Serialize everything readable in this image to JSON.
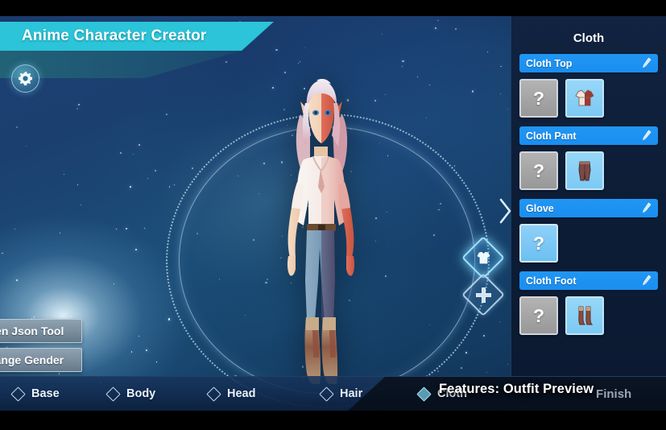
{
  "app": {
    "title": "Anime Character Creator"
  },
  "viewport": {
    "gear_icon": "gear-icon",
    "gizmos": [
      {
        "name": "outfit-gizmo",
        "icon": "shirt-icon",
        "active": true
      },
      {
        "name": "move-gizmo",
        "icon": "move-cross-icon",
        "active": false
      }
    ]
  },
  "tools": {
    "json_button": "Open Json Tool",
    "gender_button": "Change Gender"
  },
  "panel": {
    "title": "Cloth",
    "collapse_icon": "chevron-right-icon",
    "edit_icon": "pencil-icon",
    "categories": [
      {
        "label": "Cloth Top",
        "tiles": [
          {
            "type": "none",
            "label": "?",
            "selected": false
          },
          {
            "type": "item",
            "icon": "shirt-thumbnail",
            "selected": true
          }
        ]
      },
      {
        "label": "Cloth Pant",
        "tiles": [
          {
            "type": "none",
            "label": "?",
            "selected": false
          },
          {
            "type": "item",
            "icon": "pants-thumbnail",
            "selected": true
          }
        ]
      },
      {
        "label": "Glove",
        "tiles": [
          {
            "type": "none",
            "label": "?",
            "selected": true
          }
        ]
      },
      {
        "label": "Cloth Foot",
        "tiles": [
          {
            "type": "none",
            "label": "?",
            "selected": false
          },
          {
            "type": "item",
            "icon": "boots-thumbnail",
            "selected": true
          }
        ]
      }
    ]
  },
  "bottom_nav": {
    "tabs": [
      {
        "label": "Base",
        "active": false
      },
      {
        "label": "Body",
        "active": false
      },
      {
        "label": "Head",
        "active": false
      },
      {
        "label": "Hair",
        "active": false
      },
      {
        "label": "Cloth",
        "active": true
      }
    ],
    "finish_button": "Finish"
  },
  "overlay": {
    "caption": "Features: Outfit Preview"
  },
  "colors": {
    "banner": "#2bc4d8",
    "category_header": "#2196f3",
    "panel_bg": "#102340",
    "tile_selected": "#7cc9f4",
    "tile_none": "#989898",
    "accent_glow": "#9fe2ff"
  }
}
